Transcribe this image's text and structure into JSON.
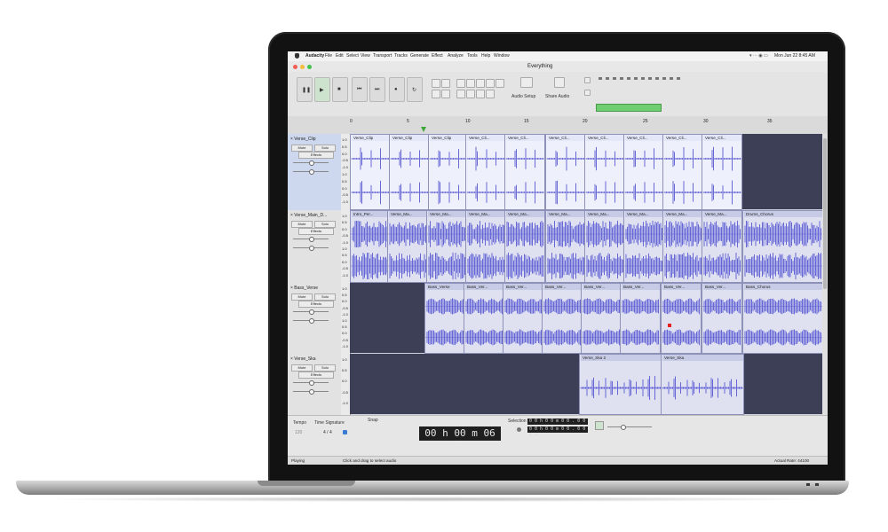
{
  "menubar": {
    "app": "Audacity",
    "items": [
      "File",
      "Edit",
      "Select",
      "View",
      "Transport",
      "Tracks",
      "Generate",
      "Effect",
      "Analyze",
      "Tools",
      "Help",
      "Window"
    ],
    "clock": "Mon Jun 22  8:45 AM"
  },
  "window": {
    "title": "Everything"
  },
  "toolbar": {
    "audio_setup": "Audio Setup",
    "share_audio": "Share Audio"
  },
  "ruler": {
    "ticks": [
      "0",
      "5",
      "10",
      "15",
      "20",
      "25",
      "30",
      "35"
    ]
  },
  "tracks": [
    {
      "name": "Verse_Clip",
      "mute": "Mute",
      "solo": "Solo",
      "effects": "Effects",
      "scale": [
        "1.0",
        "0.5",
        "0.0",
        "-0.5",
        "-1.0",
        "1.0",
        "0.5",
        "0.0",
        "-0.5",
        "-1.0"
      ],
      "clips": [
        "Verse_Clip",
        "Verse_Clip",
        "Verse_Clip",
        "Verse_Cli...",
        "Verse_Cli...",
        "Verse_Cli...",
        "Verse_Cli...",
        "Verse_Cli...",
        "Verse_Cli...",
        "Verse_Cli..."
      ]
    },
    {
      "name": "Verse_Main_D...",
      "mute": "Mute",
      "solo": "Solo",
      "effects": "Effects",
      "scale": [
        "1.0",
        "0.5",
        "0.0",
        "-0.5",
        "-1.0",
        "1.0",
        "0.5",
        "0.0",
        "-0.5",
        "-1.0"
      ],
      "clips": [
        "Intro_Per...",
        "Verse_Ma...",
        "Verse_Ma...",
        "Verse_Ma...",
        "Verse_Ma...",
        "Verse_Ma...",
        "Verse_Ma...",
        "Verse_Ma...",
        "Verse_Ma...",
        "Verse_Ma...",
        "Drums_Chorus"
      ]
    },
    {
      "name": "Bass_Verse",
      "mute": "Mute",
      "solo": "Solo",
      "effects": "Effects",
      "scale": [
        "1.0",
        "0.5",
        "0.0",
        "-0.5",
        "-1.0",
        "1.0",
        "0.5",
        "0.0",
        "-0.5",
        "-1.0"
      ],
      "clips": [
        "Bass_Verse",
        "Bass_Ver...",
        "Bass_Ver...",
        "Bass_Ver...",
        "Bass_Ver...",
        "Bass_Ver...",
        "Bass_Ver...",
        "Bass_Ver...",
        "Bass_Chorus"
      ]
    },
    {
      "name": "Verse_Ska",
      "mute": "Mute",
      "solo": "Solo",
      "effects": "Effects",
      "scale": [
        "1.0",
        "0.5",
        "0.0",
        "-0.5",
        "-1.0"
      ],
      "clips": [
        "Verse_Ska 2",
        "Verse_Ska"
      ]
    }
  ],
  "bottom": {
    "tempo_label": "Tempo",
    "tempo_value": "120",
    "time_signature_label": "Time Signature",
    "time_signature_value": "4 / 4",
    "snap_label": "Snap",
    "time_display": "00 h 00 m 06 s",
    "selection_label": "Selection",
    "selection_start": "0 0 h 0 0 m 0 0 . 0 0 0 s",
    "selection_end": "0 0 h 0 0 m 0 0 . 0 0 0 s"
  },
  "status": {
    "state": "Playing",
    "hint": "Click and drag to select audio",
    "rate": "Actual Rate: 44100"
  },
  "colors": {
    "clip": "#dfe1f1",
    "wave": "#5a5ad2",
    "empty_lane": "#3c3f55",
    "meter": "#6fce6f"
  }
}
